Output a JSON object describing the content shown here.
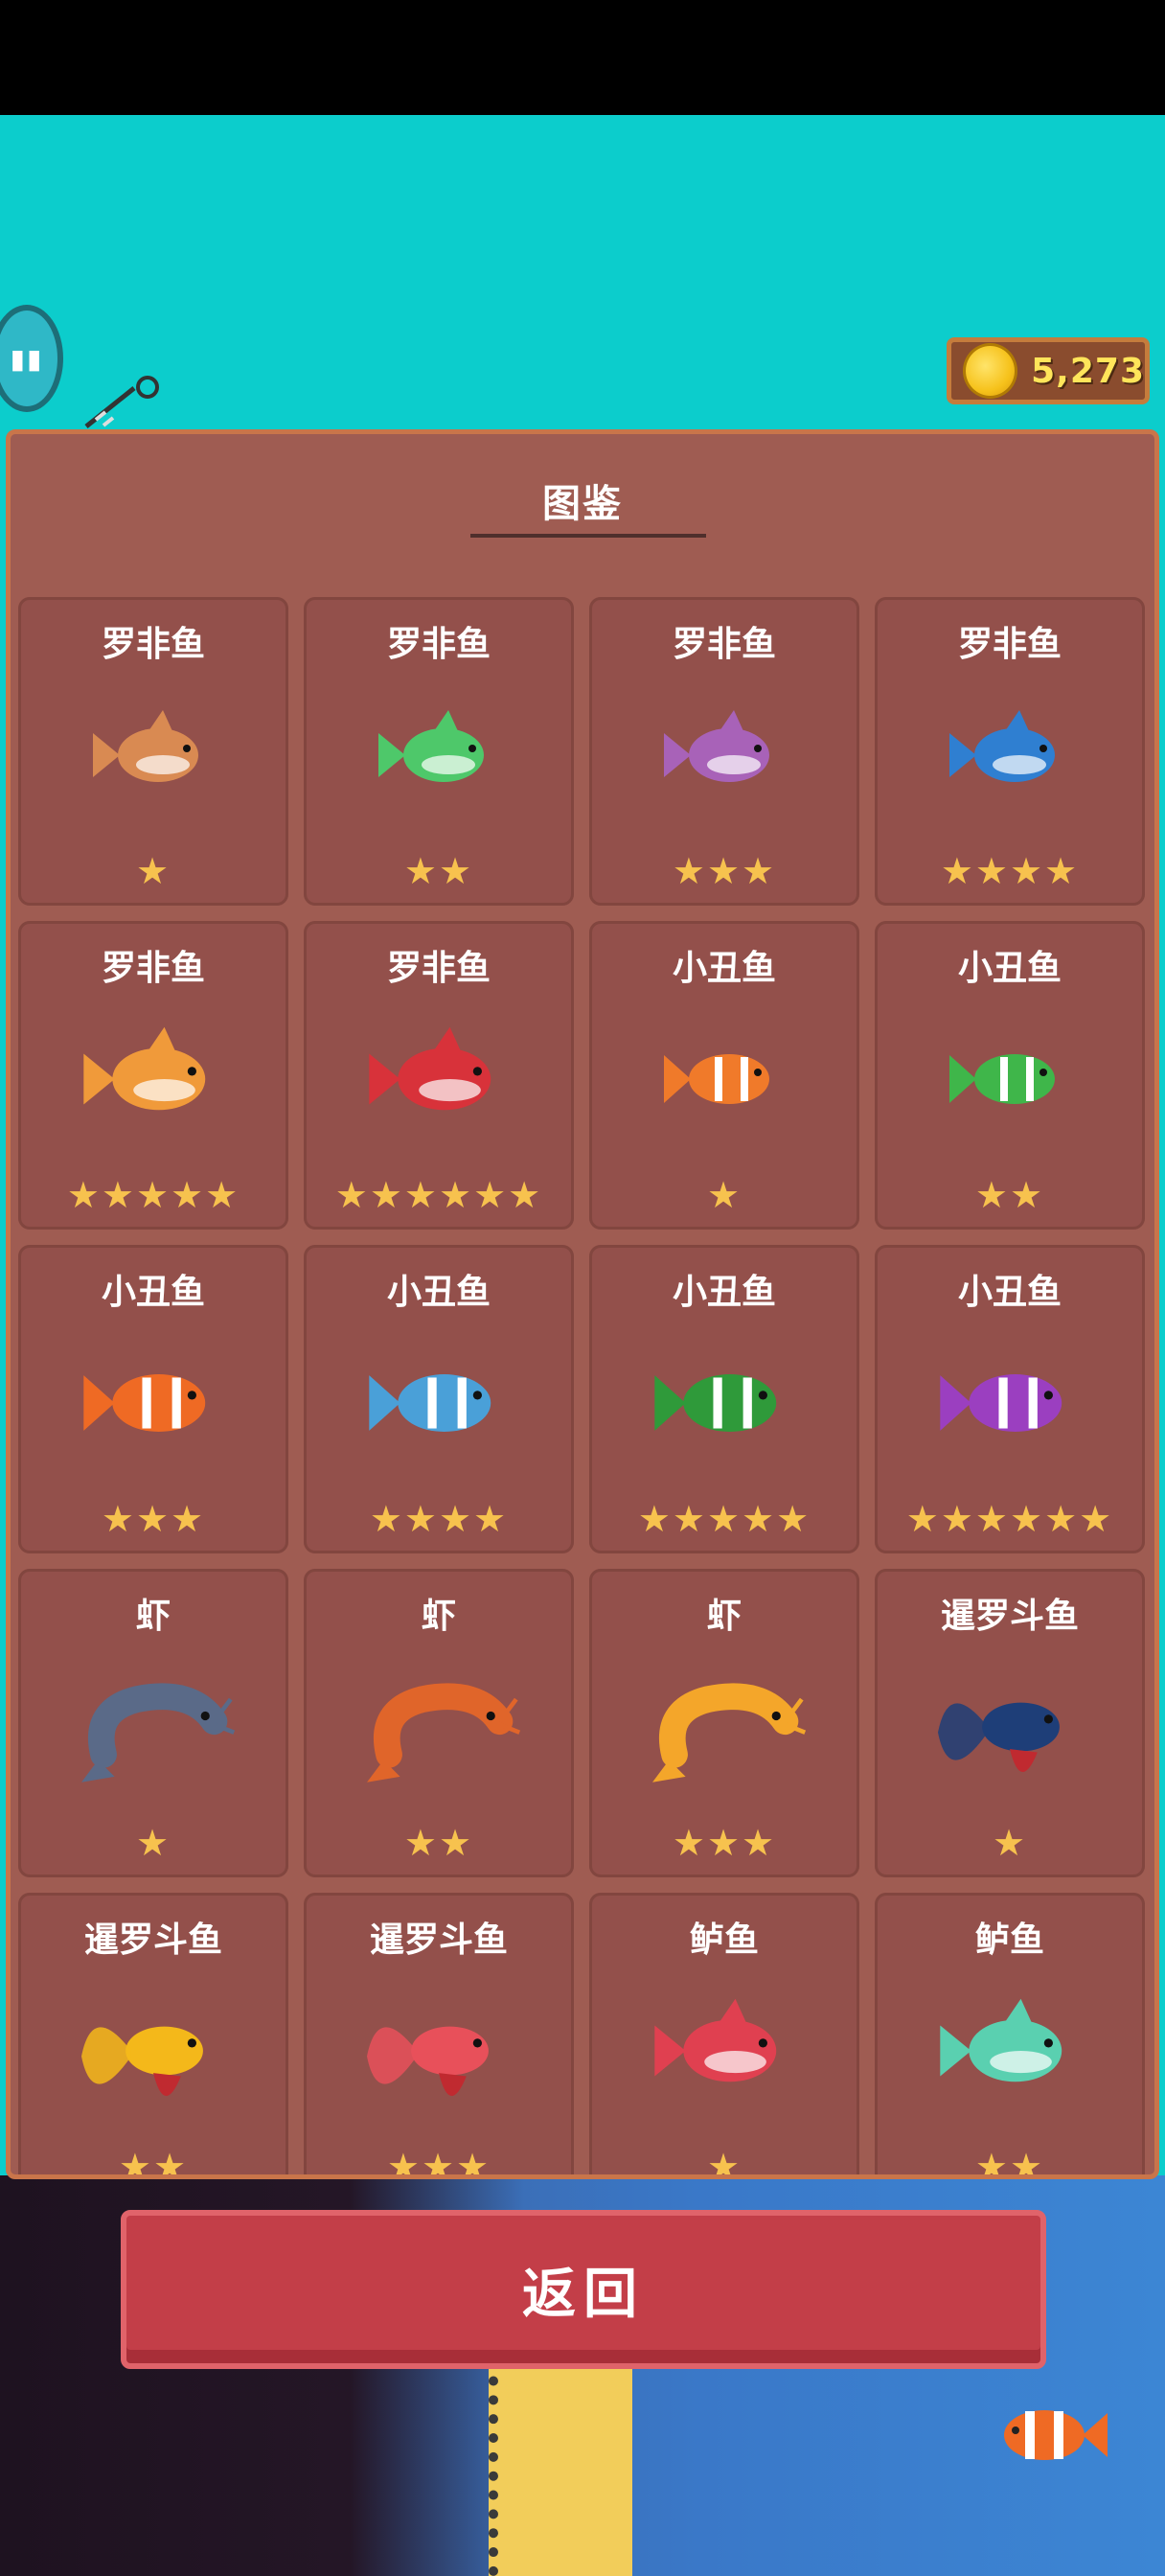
{
  "hud": {
    "coins": "5,273"
  },
  "panel": {
    "title": "图鉴"
  },
  "cards": [
    {
      "name": "罗非鱼",
      "stars": "★",
      "icon": "tilapia-brown-icon",
      "color": "#d98a52"
    },
    {
      "name": "罗非鱼",
      "stars": "★★",
      "icon": "tilapia-green-icon",
      "color": "#4ec86a"
    },
    {
      "name": "罗非鱼",
      "stars": "★★★",
      "icon": "tilapia-purple-icon",
      "color": "#a862b8"
    },
    {
      "name": "罗非鱼",
      "stars": "★★★★",
      "icon": "tilapia-blue-icon",
      "color": "#2f7fd1"
    },
    {
      "name": "罗非鱼",
      "stars": "★★★★★",
      "icon": "tilapia-orange-icon",
      "color": "#f09a3a"
    },
    {
      "name": "罗非鱼",
      "stars": "★★★★★★",
      "icon": "tilapia-red-icon",
      "color": "#d8323a"
    },
    {
      "name": "小丑鱼",
      "stars": "★",
      "icon": "clownfish-orange-icon",
      "color": "#f07a2a"
    },
    {
      "name": "小丑鱼",
      "stars": "★★",
      "icon": "clownfish-green-icon",
      "color": "#3fb64a"
    },
    {
      "name": "小丑鱼",
      "stars": "★★★",
      "icon": "clownfish-orange-large-icon",
      "color": "#ef6a24"
    },
    {
      "name": "小丑鱼",
      "stars": "★★★★",
      "icon": "clownfish-blue-icon",
      "color": "#4aa0d8"
    },
    {
      "name": "小丑鱼",
      "stars": "★★★★★",
      "icon": "clownfish-darkgreen-icon",
      "color": "#2f9a3a"
    },
    {
      "name": "小丑鱼",
      "stars": "★★★★★★",
      "icon": "clownfish-rainbow-icon",
      "color": "#9b3fc0"
    },
    {
      "name": "虾",
      "stars": "★",
      "icon": "shrimp-grey-icon",
      "color": "#5a6a88"
    },
    {
      "name": "虾",
      "stars": "★★",
      "icon": "shrimp-orange-icon",
      "color": "#e0652a"
    },
    {
      "name": "虾",
      "stars": "★★★",
      "icon": "shrimp-gold-icon",
      "color": "#f4a62a"
    },
    {
      "name": "暹罗斗鱼",
      "stars": "★",
      "icon": "betta-navy-icon",
      "color": "#1e3e78"
    },
    {
      "name": "暹罗斗鱼",
      "stars": "★★",
      "icon": "betta-yellow-icon",
      "color": "#f4b81a"
    },
    {
      "name": "暹罗斗鱼",
      "stars": "★★★",
      "icon": "betta-pink-icon",
      "color": "#e8505a"
    },
    {
      "name": "鲈鱼",
      "stars": "★",
      "icon": "bass-red-icon",
      "color": "#e04050"
    },
    {
      "name": "鲈鱼",
      "stars": "★★",
      "icon": "bass-teal-icon",
      "color": "#5ad0b0"
    }
  ],
  "buttons": {
    "back_label": "返回"
  }
}
